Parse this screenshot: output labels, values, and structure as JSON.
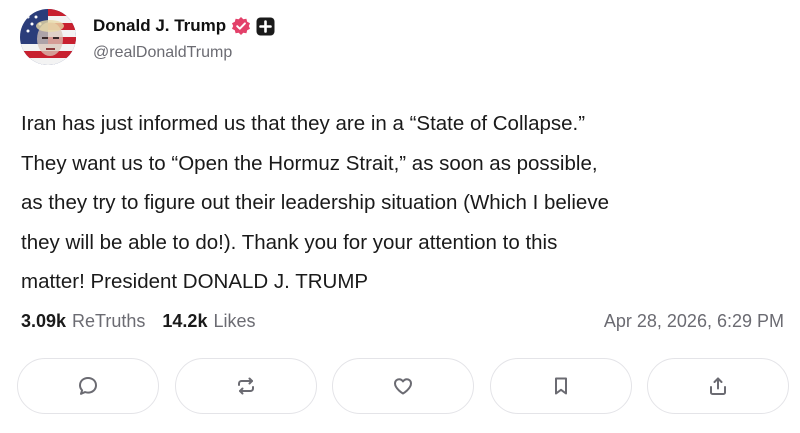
{
  "author": {
    "display_name": "Donald J. Trump",
    "handle": "@realDonaldTrump",
    "verified_badge_color": "#e3416a",
    "avatar_icon": "avatar-flag-portrait"
  },
  "post": {
    "text": "Iran has just informed us that they are in a “State of Collapse.”\nThey want us to “Open the Hormuz Strait,” as soon as possible,\nas they try to figure out their leadership situation (Which I believe\nthey will be able to do!). Thank you for your attention to this\nmatter! President DONALD J. TRUMP"
  },
  "stats": {
    "retruths_count": "3.09k",
    "retruths_label": "ReTruths",
    "likes_count": "14.2k",
    "likes_label": "Likes",
    "timestamp": "Apr 28, 2026, 6:29 PM"
  },
  "actions": [
    {
      "icon": "reply-icon"
    },
    {
      "icon": "retruth-icon"
    },
    {
      "icon": "like-icon"
    },
    {
      "icon": "bookmark-icon"
    },
    {
      "icon": "share-icon"
    }
  ],
  "colors": {
    "text": "#1a1a1a",
    "muted": "#6b6b72",
    "button_border": "#e4e4e8",
    "icon": "#6b6b72"
  }
}
